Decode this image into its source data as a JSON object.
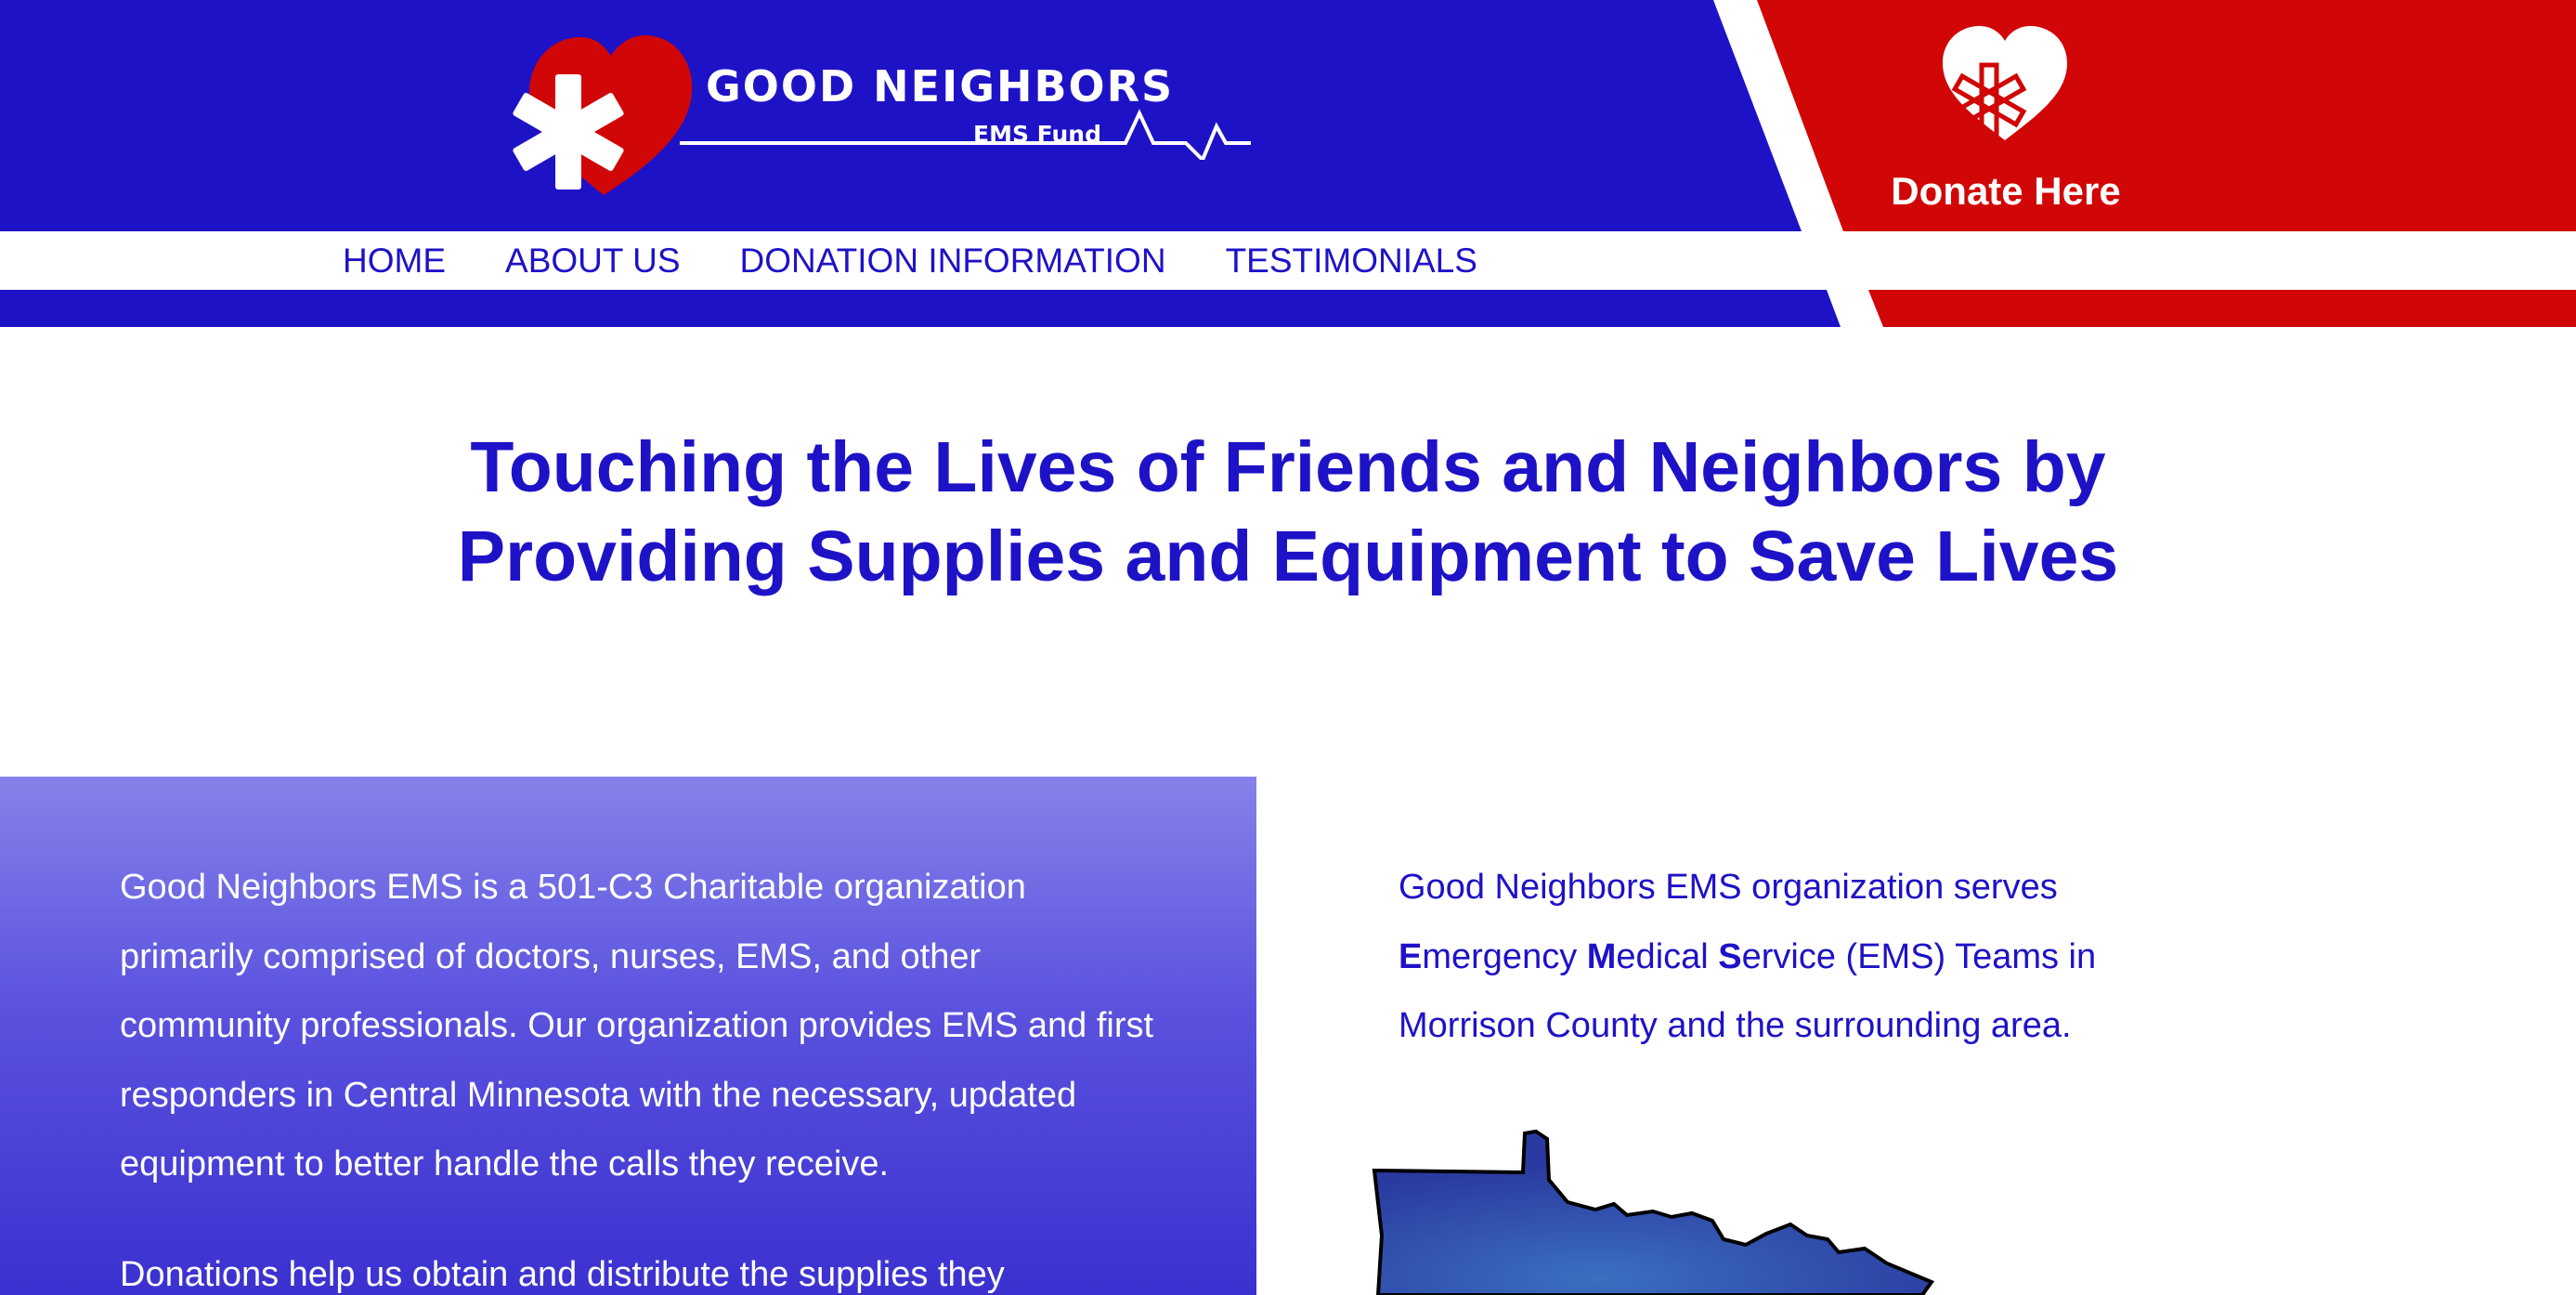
{
  "header": {
    "logo": {
      "title": "GOOD NEIGHBORS",
      "subtitle": "EMS Fund",
      "icon": "heart-star-of-life-icon"
    },
    "donate": {
      "label": "Donate Here",
      "icon": "heart-medical-icon"
    },
    "colors": {
      "blue": "#1e12c7",
      "red": "#d10606",
      "white": "#ffffff"
    }
  },
  "nav": {
    "items": [
      {
        "label": "HOME"
      },
      {
        "label": "ABOUT US"
      },
      {
        "label": "DONATION INFORMATION"
      },
      {
        "label": "TESTIMONIALS"
      }
    ]
  },
  "hero": {
    "line1": "Touching the Lives of Friends and Neighbors by",
    "line2": "Providing Supplies and Equipment to Save Lives"
  },
  "about": {
    "paragraph1": "Good Neighbors EMS is a 501-C3 Charitable organization primarily comprised of doctors, nurses, EMS, and other community professionals. Our organization provides EMS and first responders in Central Minnesota with the necessary, updated equipment to better handle the calls they receive.",
    "paragraph2": "Donations help us obtain and distribute the supplies they"
  },
  "serves": {
    "intro": "Good Neighbors EMS organization serves",
    "e": "E",
    "e_rest": "mergency ",
    "m": "M",
    "m_rest": "edical ",
    "s": "S",
    "s_rest": "ervice (EMS) Teams in",
    "line3": "Morrison County and the surrounding area."
  },
  "map": {
    "icon": "minnesota-map-icon"
  }
}
